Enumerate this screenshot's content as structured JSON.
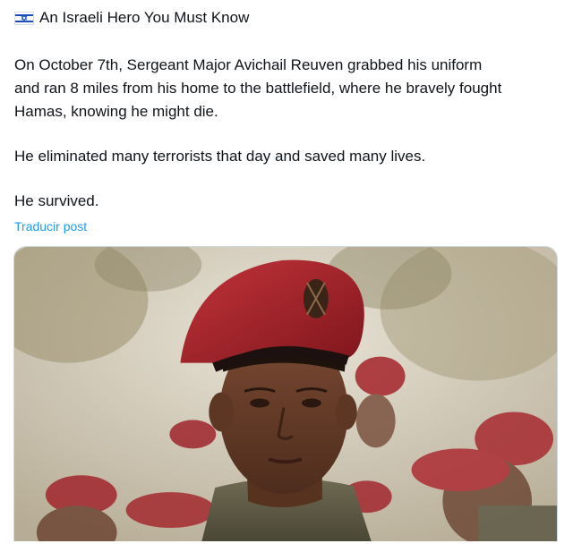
{
  "post": {
    "flag_icon": "israel-flag-icon",
    "title": "An Israeli Hero You Must Know",
    "paragraphs": [
      "On October 7th, Sergeant Major Avichail Reuven grabbed his uniform\nand ran 8 miles from his home to the battlefield, where he bravely fought\nHamas, knowing he might die.",
      "He eliminated many terrorists that day and saved many lives.",
      "He survived."
    ],
    "translate_label": "Traducir post"
  },
  "colors": {
    "text": "#0f1419",
    "link": "#1d9bf0",
    "beret": "#a3252c",
    "border": "#cfd9de"
  }
}
